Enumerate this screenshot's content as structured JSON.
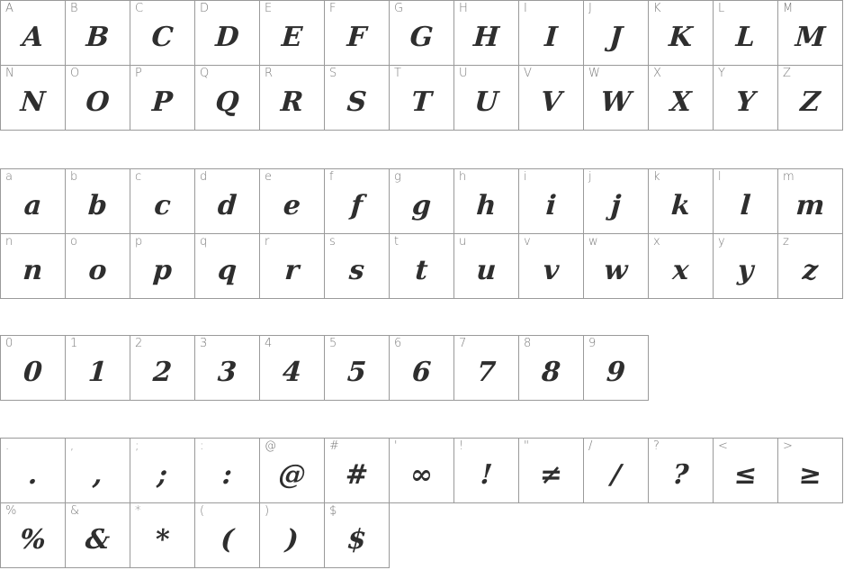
{
  "colors": {
    "border": "#9a9a9a",
    "label": "#7a7a7a",
    "glyph": "#2e2e2e"
  },
  "sections": [
    {
      "name": "uppercase",
      "rows": [
        [
          [
            "A",
            "A"
          ],
          [
            "B",
            "B"
          ],
          [
            "C",
            "C"
          ],
          [
            "D",
            "D"
          ],
          [
            "E",
            "E"
          ],
          [
            "F",
            "F"
          ],
          [
            "G",
            "G"
          ],
          [
            "H",
            "H"
          ],
          [
            "I",
            "I"
          ],
          [
            "J",
            "J"
          ],
          [
            "K",
            "K"
          ],
          [
            "L",
            "L"
          ],
          [
            "M",
            "M"
          ]
        ],
        [
          [
            "N",
            "N"
          ],
          [
            "O",
            "O"
          ],
          [
            "P",
            "P"
          ],
          [
            "Q",
            "Q"
          ],
          [
            "R",
            "R"
          ],
          [
            "S",
            "S"
          ],
          [
            "T",
            "T"
          ],
          [
            "U",
            "U"
          ],
          [
            "V",
            "V"
          ],
          [
            "W",
            "W"
          ],
          [
            "X",
            "X"
          ],
          [
            "Y",
            "Y"
          ],
          [
            "Z",
            "Z"
          ]
        ]
      ]
    },
    {
      "name": "lowercase",
      "rows": [
        [
          [
            "a",
            "a"
          ],
          [
            "b",
            "b"
          ],
          [
            "c",
            "c"
          ],
          [
            "d",
            "d"
          ],
          [
            "e",
            "e"
          ],
          [
            "f",
            "f"
          ],
          [
            "g",
            "g"
          ],
          [
            "h",
            "h"
          ],
          [
            "i",
            "i"
          ],
          [
            "j",
            "j"
          ],
          [
            "k",
            "k"
          ],
          [
            "l",
            "l"
          ],
          [
            "m",
            "m"
          ]
        ],
        [
          [
            "n",
            "n"
          ],
          [
            "o",
            "o"
          ],
          [
            "p",
            "p"
          ],
          [
            "q",
            "q"
          ],
          [
            "r",
            "r"
          ],
          [
            "s",
            "s"
          ],
          [
            "t",
            "t"
          ],
          [
            "u",
            "u"
          ],
          [
            "v",
            "v"
          ],
          [
            "w",
            "w"
          ],
          [
            "x",
            "x"
          ],
          [
            "y",
            "y"
          ],
          [
            "z",
            "z"
          ]
        ]
      ]
    },
    {
      "name": "digits",
      "rows": [
        [
          [
            "0",
            "0"
          ],
          [
            "1",
            "1"
          ],
          [
            "2",
            "2"
          ],
          [
            "3",
            "3"
          ],
          [
            "4",
            "4"
          ],
          [
            "5",
            "5"
          ],
          [
            "6",
            "6"
          ],
          [
            "7",
            "7"
          ],
          [
            "8",
            "8"
          ],
          [
            "9",
            "9"
          ]
        ]
      ]
    },
    {
      "name": "punctuation",
      "rows": [
        [
          [
            ".",
            "."
          ],
          [
            ",",
            ","
          ],
          [
            ";",
            ";"
          ],
          [
            ":",
            ":"
          ],
          [
            "@",
            "@"
          ],
          [
            "#",
            "#"
          ],
          [
            "'",
            "∞"
          ],
          [
            "!",
            "!"
          ],
          [
            "\"",
            "≠"
          ],
          [
            "/",
            "/"
          ],
          [
            "?",
            "?"
          ],
          [
            "<",
            "≤"
          ],
          [
            ">",
            "≥"
          ]
        ],
        [
          [
            "%",
            "%"
          ],
          [
            "&",
            "&"
          ],
          [
            "*",
            "*"
          ],
          [
            "(",
            "("
          ],
          [
            ")",
            ")"
          ],
          [
            "$",
            "$"
          ]
        ]
      ]
    }
  ]
}
